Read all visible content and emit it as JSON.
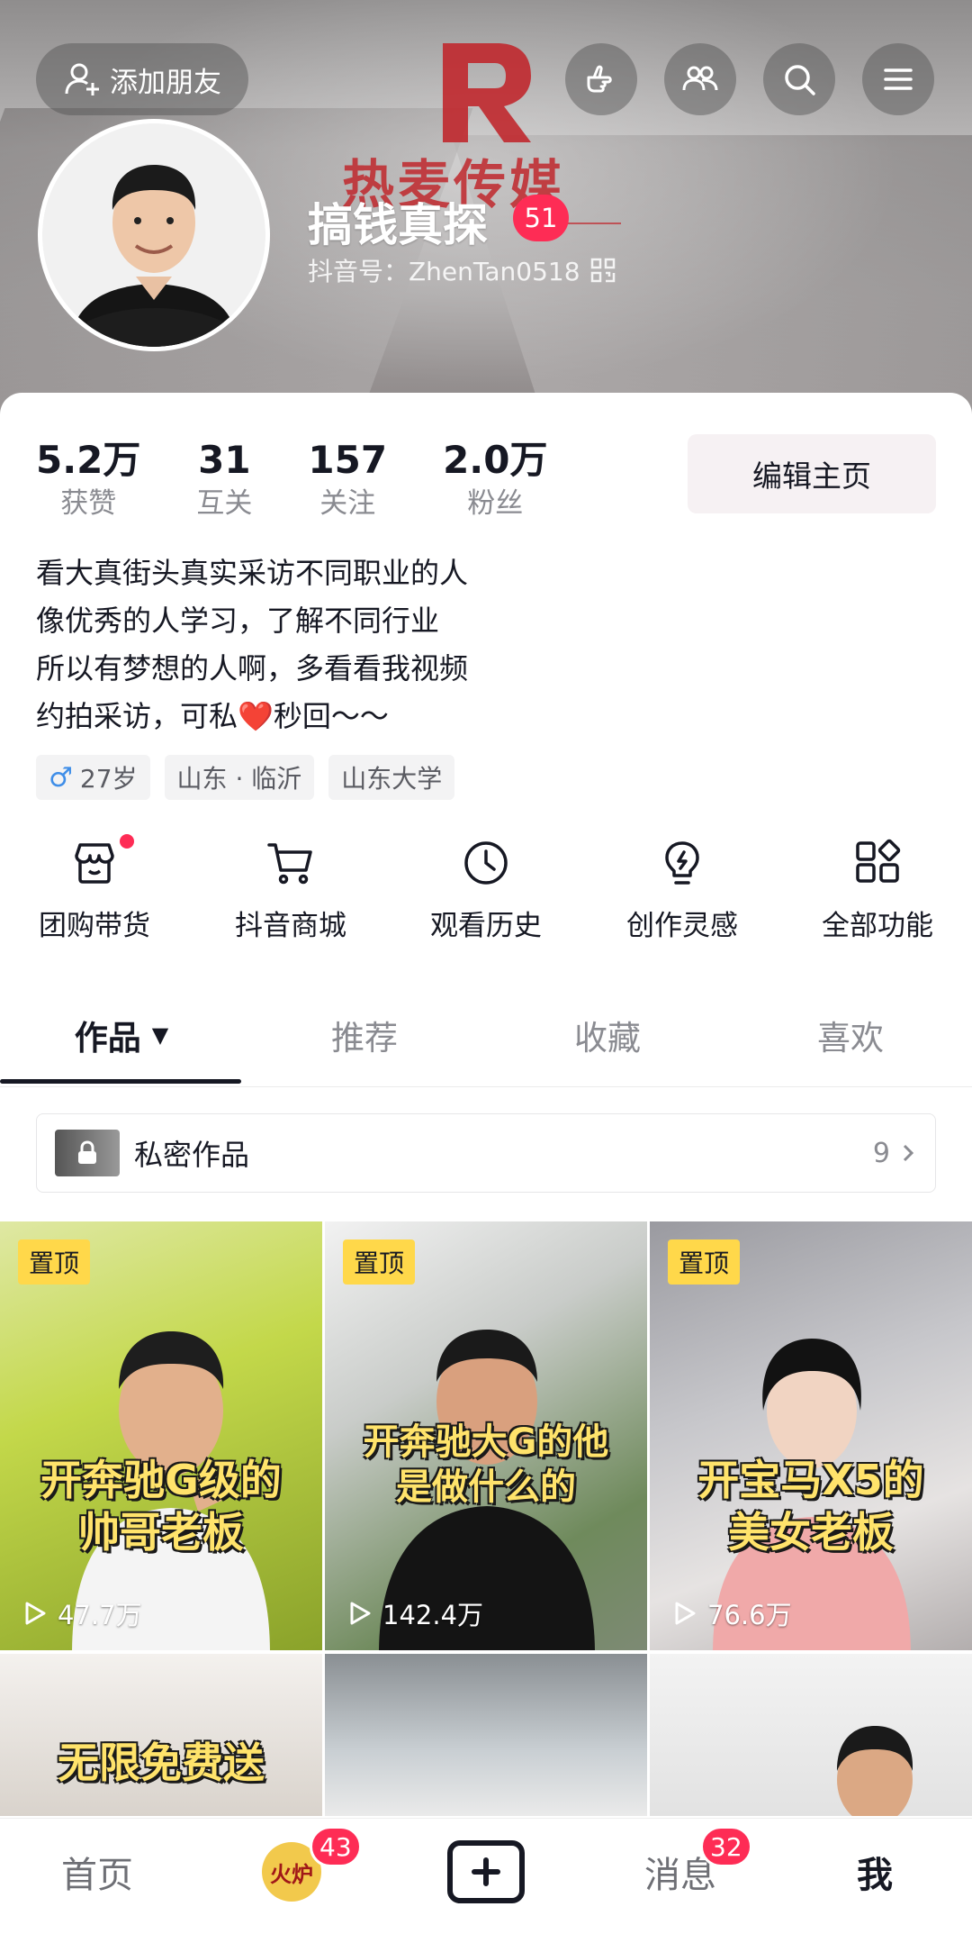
{
  "header": {
    "add_friend_label": "添加朋友",
    "banner_logo_text": "热麦传媒",
    "icons": [
      "hand-pointer-icon",
      "friends-icon",
      "search-icon",
      "menu-icon"
    ]
  },
  "profile": {
    "nickname": "搞钱真探",
    "level": "51",
    "douyin_id": "抖音号：ZhenTan0518",
    "stats": [
      {
        "value": "5.2万",
        "label": "获赞"
      },
      {
        "value": "31",
        "label": "互关"
      },
      {
        "value": "157",
        "label": "关注"
      },
      {
        "value": "2.0万",
        "label": "粉丝"
      }
    ],
    "edit_button": "编辑主页",
    "bio": {
      "line1": "看大真街头真实采访不同职业的人",
      "line2": "像优秀的人学习，了解不同行业",
      "line3": "所以有梦想的人啊，多看看我视频",
      "line4_a": "约拍采访，可私",
      "line4_heart": "❤️",
      "line4_b": "秒回～～"
    },
    "tags": {
      "gender_symbol": "♂",
      "age": "27岁",
      "location": "山东 · 临沂",
      "school": "山东大学"
    }
  },
  "features": [
    {
      "label": "团购带货",
      "icon": "group-buy-icon",
      "has_dot": true
    },
    {
      "label": "抖音商城",
      "icon": "cart-icon"
    },
    {
      "label": "观看历史",
      "icon": "clock-icon"
    },
    {
      "label": "创作灵感",
      "icon": "bulb-icon"
    },
    {
      "label": "全部功能",
      "icon": "apps-icon"
    }
  ],
  "tabs": [
    {
      "label": "作品",
      "active": true
    },
    {
      "label": "推荐"
    },
    {
      "label": "收藏"
    },
    {
      "label": "喜欢"
    }
  ],
  "private_works": {
    "label": "私密作品",
    "count": "9"
  },
  "videos": [
    {
      "pinned": "置顶",
      "caption_line1": "开奔驰G级的",
      "caption_line2": "帅哥老板",
      "plays": "47.7万"
    },
    {
      "pinned": "置顶",
      "caption_line1": "开奔驰大G的他",
      "caption_line2": "是做什么的",
      "plays": "142.4万"
    },
    {
      "pinned": "置顶",
      "caption_line1": "开宝马X5的",
      "caption_line2": "美女老板",
      "plays": "76.6万"
    },
    {
      "caption_line1": "无限免费送"
    },
    {},
    {}
  ],
  "bottom_nav": {
    "home": "首页",
    "friends_badge": "43",
    "friends_avatar_text": "火炉",
    "messages": "消息",
    "messages_badge": "32",
    "me": "我"
  },
  "colors": {
    "accent": "#fe2c55",
    "pin": "#ffd84a",
    "caption": "#ffe36b",
    "logo_red": "#c0282d"
  }
}
